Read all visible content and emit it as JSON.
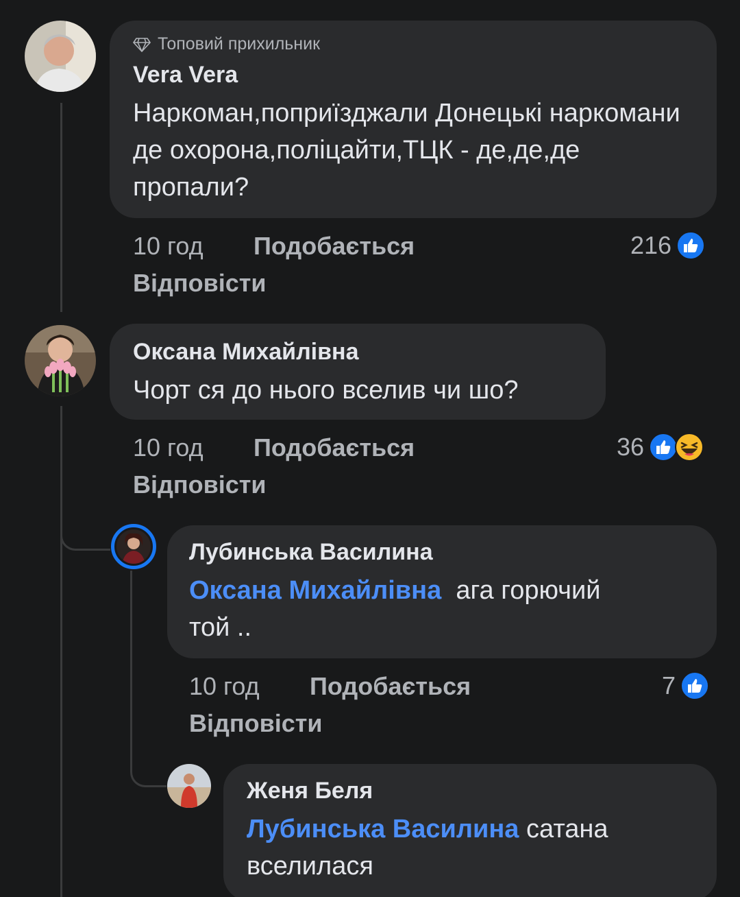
{
  "comments": [
    {
      "badge": "Топовий прихильник",
      "author": "Vera Vera",
      "text": "Наркоман,поприїзджали Донецькі наркомани де охорона,поліцайти,ТЦК - де,де,де пропали?",
      "time": "10 год",
      "like_label": "Подобається",
      "reply_label": "Відповісти",
      "reaction_count": "216",
      "reactions": [
        "like-icon"
      ]
    },
    {
      "author": "Оксана Михайлівна",
      "text": "Чорт ся до нього вселив чи шо?",
      "time": "10 год",
      "like_label": "Подобається",
      "reply_label": "Відповісти",
      "reaction_count": "36",
      "reactions": [
        "like-icon",
        "haha-icon"
      ]
    },
    {
      "author": "Лубинська Василина",
      "mention": "Оксана Михайлівна",
      "text_line1": "ага горючий",
      "text_line2": "той ..",
      "time": "10 год",
      "like_label": "Подобається",
      "reply_label": "Відповісти",
      "reaction_count": "7",
      "reactions": [
        "like-icon"
      ]
    },
    {
      "author": "Женя Беля",
      "mention": "Лубинська Василина",
      "text_line1": "сатана",
      "text_line2": "вселилася"
    }
  ],
  "colors": {
    "background": "#18191a",
    "bubble": "#2a2b2d",
    "mention": "#4c8ef7",
    "like_blue": "#1877f2",
    "haha_yellow": "#f7b928"
  }
}
